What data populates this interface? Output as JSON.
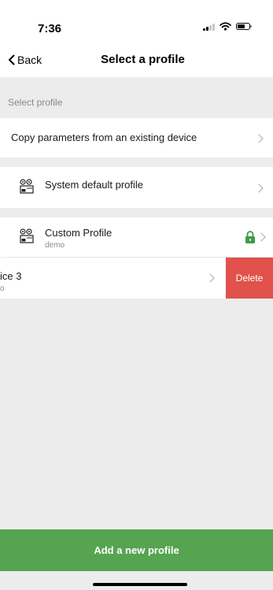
{
  "status_bar": {
    "time": "7:36"
  },
  "nav": {
    "back_label": "Back",
    "title": "Select a profile"
  },
  "section": {
    "label": "Select profile"
  },
  "rows": {
    "copy": {
      "label": "Copy parameters from an existing device"
    },
    "system_default": {
      "label": "System default profile"
    },
    "custom": {
      "label": "Custom Profile",
      "sub": "demo"
    },
    "swiped": {
      "label": "ice 3",
      "sub": "o",
      "delete_label": "Delete"
    }
  },
  "footer": {
    "add_label": "Add a new profile"
  },
  "colors": {
    "accent_green": "#56a352",
    "delete_red": "#e0524b",
    "lock_green": "#3f9a46",
    "background": "#ececec"
  },
  "icons": [
    "signal-icon",
    "wifi-icon",
    "battery-icon",
    "back-chevron-icon",
    "chevron-right-icon",
    "device-icon",
    "lock-icon"
  ]
}
